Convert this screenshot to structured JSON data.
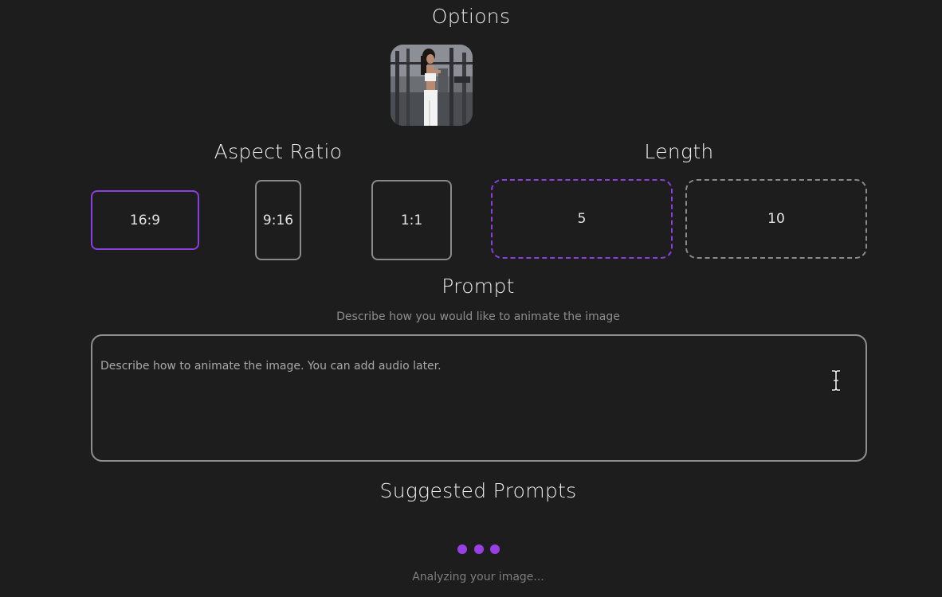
{
  "options": {
    "title": "Options"
  },
  "thumbnail": {
    "alt": "Woman standing in a gym"
  },
  "aspect_ratio": {
    "title": "Aspect Ratio",
    "choices": [
      "16:9",
      "9:16",
      "1:1"
    ],
    "selected": "16:9"
  },
  "length": {
    "title": "Length",
    "choices": [
      "5",
      "10"
    ],
    "selected": "5"
  },
  "prompt": {
    "title": "Prompt",
    "subtitle": "Describe how you would like to animate the image",
    "placeholder": "Describe how to animate the image. You can add audio later.",
    "value": ""
  },
  "suggested": {
    "title": "Suggested Prompts",
    "status": "Analyzing your image..."
  },
  "colors": {
    "background": "#1d1d1e",
    "accent": "#8b3fe0",
    "border": "#8a8a8a"
  }
}
